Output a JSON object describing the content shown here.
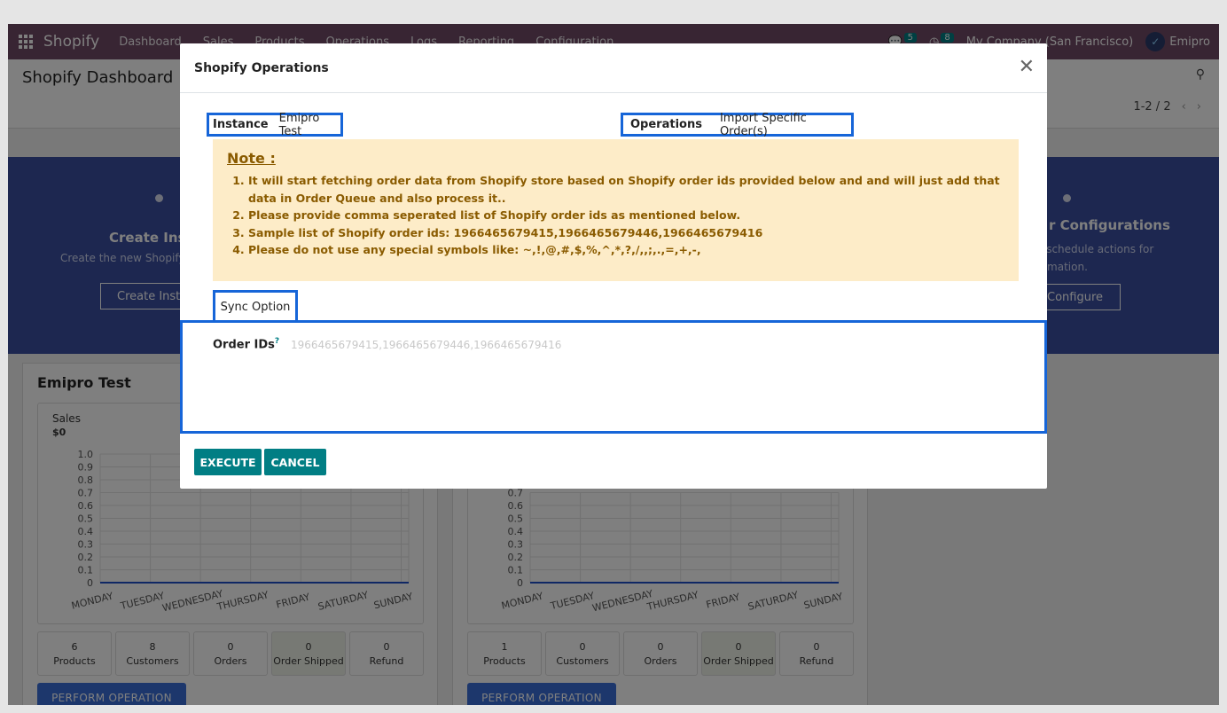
{
  "navbar": {
    "brand": "Shopify",
    "items": [
      "Dashboard",
      "Sales",
      "Products",
      "Operations",
      "Logs",
      "Reporting",
      "Configuration"
    ],
    "messages_count": "5",
    "activities_count": "8",
    "company": "My Company (San Francisco)",
    "user": "Emipro"
  },
  "control_panel": {
    "title": "Shopify Dashboard",
    "pager": "1-2 / 2"
  },
  "banner": {
    "left_title": "Create Inst",
    "left_subtitle": "Create the new Shopify",
    "left_button": "Create Insta",
    "right_title": "r Configurations",
    "right_subtitle_1": "e schedule actions for",
    "right_subtitle_2": "tomation.",
    "right_button": "Configure"
  },
  "cards": [
    {
      "title": "Emipro Test",
      "chart_label": "Sales",
      "chart_total": "$0",
      "stats": [
        {
          "value": "6",
          "label": "Products"
        },
        {
          "value": "8",
          "label": "Customers"
        },
        {
          "value": "0",
          "label": "Orders"
        },
        {
          "value": "0",
          "label": "Order Shipped"
        },
        {
          "value": "0",
          "label": "Refund"
        }
      ],
      "button": "PERFORM OPERATION"
    },
    {
      "title": "",
      "chart_label": "",
      "chart_total": "",
      "stats": [
        {
          "value": "1",
          "label": "Products"
        },
        {
          "value": "0",
          "label": "Customers"
        },
        {
          "value": "0",
          "label": "Orders"
        },
        {
          "value": "0",
          "label": "Order Shipped"
        },
        {
          "value": "0",
          "label": "Refund"
        }
      ],
      "button": "PERFORM OPERATION"
    }
  ],
  "chart_data": [
    {
      "type": "line",
      "categories": [
        "MONDAY",
        "TUESDAY",
        "WEDNESDAY",
        "THURSDAY",
        "FRIDAY",
        "SATURDAY",
        "SUNDAY"
      ],
      "series": [
        {
          "values": [
            0,
            0,
            0,
            0,
            0,
            0,
            0
          ]
        }
      ],
      "yticks": [
        "0",
        "0.1",
        "0.2",
        "0.3",
        "0.4",
        "0.5",
        "0.6",
        "0.7",
        "0.8",
        "0.9",
        "1.0"
      ],
      "ylim": [
        0,
        1
      ],
      "color": "#1f4fc8"
    },
    {
      "type": "line",
      "categories": [
        "MONDAY",
        "TUESDAY",
        "WEDNESDAY",
        "THURSDAY",
        "FRIDAY",
        "SATURDAY",
        "SUNDAY"
      ],
      "series": [
        {
          "values": [
            0,
            0,
            0,
            0,
            0,
            0,
            0
          ]
        }
      ],
      "yticks": [
        "0",
        "0.1",
        "0.2",
        "0.3",
        "0.4",
        "0.5",
        "0.6",
        "0.7"
      ],
      "ylim": [
        0,
        1
      ],
      "color": "#1f4fc8"
    }
  ],
  "modal": {
    "title": "Shopify Operations",
    "instance_label": "Instance",
    "instance_value": "Emipro Test",
    "operations_label": "Operations",
    "operations_value": "Import Specific Order(s)",
    "note_title": "Note :",
    "note_items": [
      "It will start fetching order data from Shopify store based on Shopify order ids provided below and and will just add that data in Order Queue and also process it..",
      "Please provide comma seperated list of Shopify order ids as mentioned below.",
      "Sample list of Shopify order ids: 1966465679415,1966465679446,1966465679416",
      "Please do not use any special symbols like: ~,!,@,#,$,%,^,*,?,/,,;,.,=,+,-,"
    ],
    "tab_label": "Sync Option",
    "order_ids_label": "Order IDs",
    "order_ids_help": "?",
    "order_ids_value": "",
    "order_ids_placeholder": "1966465679415,1966465679446,1966465679416",
    "execute_label": "EXECUTE",
    "cancel_label": "CANCEL"
  },
  "colors": {
    "navbar": "#714B67",
    "primary": "#017E84",
    "highlight_border": "#1665d8",
    "note_bg": "#fdecc8",
    "note_text": "#8a5b00"
  }
}
